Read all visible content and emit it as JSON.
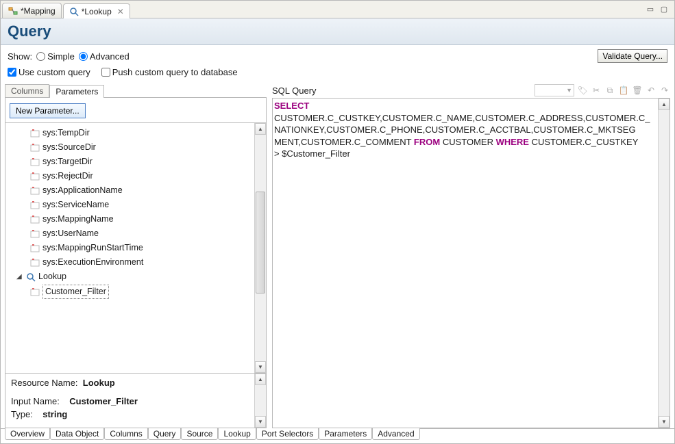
{
  "editor_tabs": {
    "mapping": "*Mapping",
    "lookup": "*Lookup"
  },
  "title": "Query",
  "show": {
    "label": "Show:",
    "simple": "Simple",
    "advanced": "Advanced",
    "selected": "advanced"
  },
  "validate_button": "Validate Query...",
  "custom_query": {
    "use_custom": "Use custom query",
    "use_custom_checked": true,
    "push_db": "Push custom query to database",
    "push_db_checked": false
  },
  "left_tabs": {
    "columns": "Columns",
    "parameters": "Parameters",
    "active": "parameters"
  },
  "new_parameter_button": "New Parameter...",
  "variables": [
    "sys:TempDir",
    "sys:SourceDir",
    "sys:TargetDir",
    "sys:RejectDir",
    "sys:ApplicationName",
    "sys:ServiceName",
    "sys:MappingName",
    "sys:UserName",
    "sys:MappingRunStartTime",
    "sys:ExecutionEnvironment"
  ],
  "lookup_node": {
    "label": "Lookup",
    "child": "Customer_Filter"
  },
  "properties": {
    "resource_name_label": "Resource Name:",
    "resource_name_value": "Lookup",
    "input_name_label": "Input Name:",
    "input_name_value": "Customer_Filter",
    "type_label": "Type:",
    "type_value": "string"
  },
  "sql": {
    "label": "SQL Query",
    "kw_select": "SELECT",
    "line1": "CUSTOMER.C_CUSTKEY,CUSTOMER.C_NAME,CUSTOMER.C_ADDRESS,CUSTOMER.C_",
    "line2": "NATIONKEY,CUSTOMER.C_PHONE,CUSTOMER.C_ACCTBAL,CUSTOMER.C_MKTSEG",
    "line3a": "MENT,CUSTOMER.C_COMMENT ",
    "kw_from": "FROM",
    "line3b": " CUSTOMER ",
    "kw_where": "WHERE",
    "line3c": " CUSTOMER.C_CUSTKEY",
    "line4": "> $Customer_Filter"
  },
  "bottom_tabs": [
    "Overview",
    "Data Object",
    "Columns",
    "Query",
    "Source",
    "Lookup",
    "Port Selectors",
    "Parameters",
    "Advanced"
  ],
  "bottom_active": "Query"
}
